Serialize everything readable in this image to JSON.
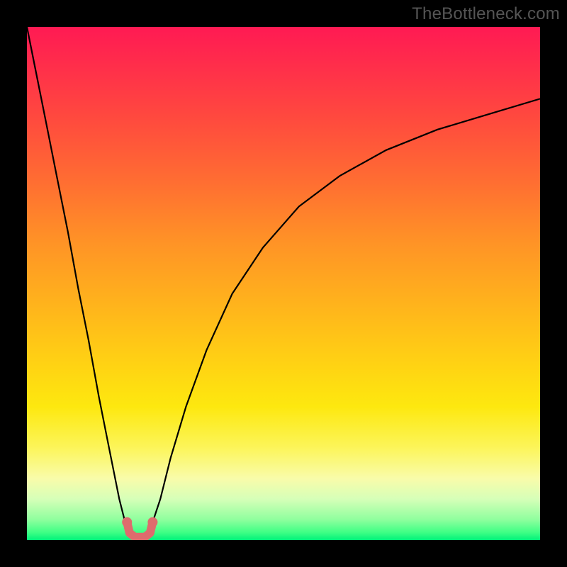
{
  "watermark": "TheBottleneck.com",
  "colors": {
    "background": "#000000",
    "curve": "#000000",
    "marker": "#de6b6d",
    "gradient_top": "#ff1a53",
    "gradient_mid": "#ffd313",
    "gradient_bottom": "#00f27a"
  },
  "chart_data": {
    "type": "line",
    "title": "",
    "xlabel": "",
    "ylabel": "",
    "xlim": [
      0,
      100
    ],
    "ylim": [
      0,
      100
    ],
    "grid": false,
    "legend": false,
    "annotations": [
      {
        "text": "TheBottleneck.com",
        "position": "top-right"
      }
    ],
    "series": [
      {
        "name": "left-branch",
        "x": [
          0,
          2,
          4,
          6,
          8,
          10,
          12,
          14,
          16,
          18,
          19,
          20,
          21
        ],
        "y": [
          100,
          90,
          80,
          70,
          60,
          49,
          39,
          28,
          18,
          8,
          4,
          1.5,
          0.6
        ]
      },
      {
        "name": "right-branch",
        "x": [
          23,
          24,
          26,
          28,
          31,
          35,
          40,
          46,
          53,
          61,
          70,
          80,
          90,
          100
        ],
        "y": [
          0.6,
          2,
          8,
          16,
          26,
          37,
          48,
          57,
          65,
          71,
          76,
          80,
          83,
          86
        ]
      },
      {
        "name": "bottom-marker",
        "x": [
          19.5,
          20,
          21,
          22,
          23,
          24,
          24.5
        ],
        "y": [
          3.5,
          1.4,
          0.6,
          0.6,
          0.6,
          1.4,
          3.5
        ]
      }
    ],
    "minimum": {
      "x": 22,
      "y": 0.6
    }
  }
}
